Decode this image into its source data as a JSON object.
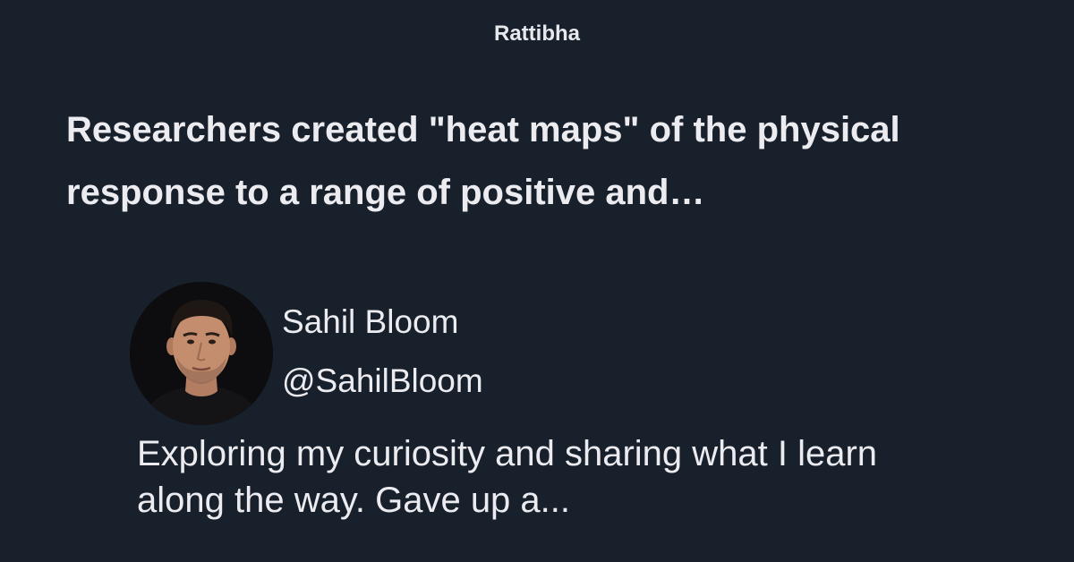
{
  "site": {
    "name": "Rattibha"
  },
  "thread": {
    "title": "Researchers created \"heat maps\" of the physical response to a range of positive and…"
  },
  "author": {
    "name": "Sahil Bloom",
    "handle": "@SahilBloom",
    "avatar_icon": "profile-photo",
    "bio": "Exploring my curiosity and sharing what I learn along the way. Gave up a..."
  },
  "colors": {
    "background": "#18202c",
    "text": "#ececf0"
  }
}
